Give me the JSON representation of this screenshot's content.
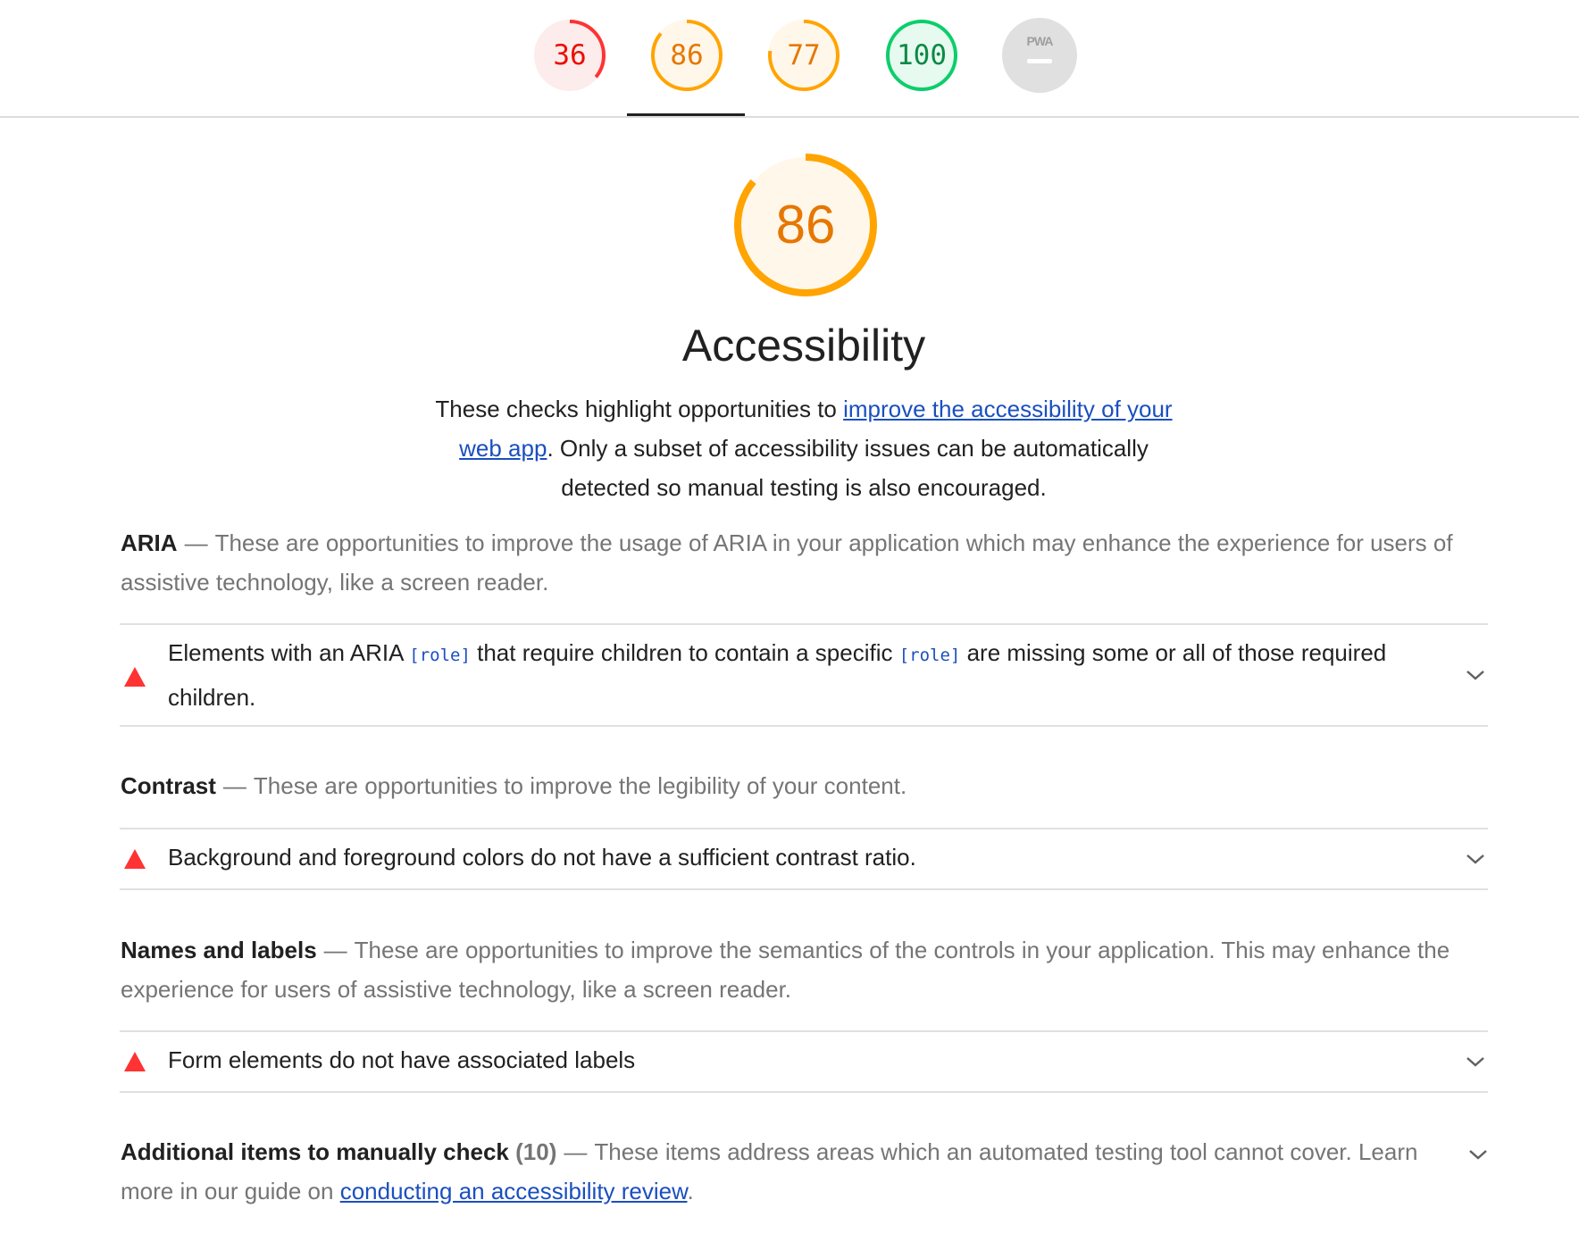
{
  "gauges": [
    {
      "name": "performance",
      "value": "36",
      "score": 0.36,
      "color": "#f33",
      "bg": "#fdecec",
      "text_color": "#eb0f00"
    },
    {
      "name": "accessibility",
      "value": "86",
      "score": 0.86,
      "color": "#ffa400",
      "bg": "#fff7ea",
      "text_color": "#e67700"
    },
    {
      "name": "best-practices",
      "value": "77",
      "score": 0.77,
      "color": "#ffa400",
      "bg": "#fff7ea",
      "text_color": "#e67700"
    },
    {
      "name": "seo",
      "value": "100",
      "score": 1.0,
      "color": "#0cce6b",
      "bg": "#e7faf0",
      "text_color": "#0c8a45"
    },
    {
      "name": "pwa",
      "label": "PWA",
      "value": "",
      "color": "#9e9e9e",
      "bg": "#e0e0e0"
    }
  ],
  "main": {
    "score": "86",
    "score_fraction": 0.86,
    "title": "Accessibility",
    "intro_before": "These checks highlight opportunities to ",
    "intro_link": "improve the accessibility of your web app",
    "intro_after": ". Only a subset of accessibility issues can be automatically detected so manual testing is also encouraged."
  },
  "groups": [
    {
      "title": "ARIA",
      "description": "These are opportunities to improve the usage of ARIA in your application which may enhance the experience for users of assistive technology, like a screen reader.",
      "audit": {
        "part1": "Elements with an ARIA ",
        "code1": "[role]",
        "part2": " that require children to contain a specific ",
        "code2": "[role]",
        "part3": " are missing some or all of those required children."
      }
    },
    {
      "title": "Contrast",
      "description": "These are opportunities to improve the legibility of your content.",
      "audit": {
        "text": "Background and foreground colors do not have a sufficient contrast ratio."
      }
    },
    {
      "title": "Names and labels",
      "description": "These are opportunities to improve the semantics of the controls in your application. This may enhance the experience for users of assistive technology, like a screen reader.",
      "audit": {
        "text": "Form elements do not have associated labels"
      }
    }
  ],
  "manual": {
    "title": "Additional items to manually check",
    "count": "(10)",
    "description": "These items address areas which an automated testing tool cannot cover. Learn more in our guide on ",
    "link": "conducting an accessibility review",
    "end": "."
  },
  "colors": {
    "fail": "#f33",
    "link": "#1a4fbf",
    "average": "#ffa400"
  }
}
